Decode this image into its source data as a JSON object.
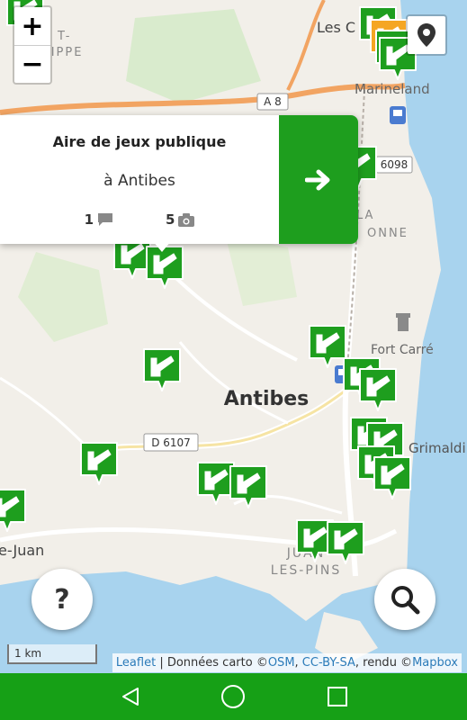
{
  "map": {
    "labels": {
      "antibes": "Antibes",
      "les_c": "Les C",
      "marineland": "Marineland",
      "fort_carre": "Fort Carré",
      "grimaldi": "Grimaldi",
      "juan_les_pins_1": "JUAN",
      "juan_les_pins_2": "LES-PINS",
      "juan_left": "e-Juan",
      "philippe": "PHILIPPE",
      "la": "LA",
      "onne": "ONNE",
      "t_frag": "T-"
    },
    "road_shields": {
      "a8": "A 8",
      "d6107": "D 6107",
      "r6098": "6098"
    },
    "colors": {
      "land": "#f2efe9",
      "sea": "#a8d3ee",
      "road": "#ffffff",
      "motorway": "#f2a462",
      "park": "#cfe9c0",
      "marker_green": "#1e9e1e",
      "marker_orange": "#f5a623"
    }
  },
  "zoom": {
    "in_label": "+",
    "out_label": "−"
  },
  "popup": {
    "title": "Aire de jeux publique",
    "location": "à Antibes",
    "comments_count": "1",
    "photos_count": "5",
    "comment_icon": "speech-bubble-icon",
    "photo_icon": "camera-icon",
    "go_icon": "arrow-right-icon"
  },
  "help_button": {
    "label": "?"
  },
  "search_button": {
    "icon": "magnifier-icon"
  },
  "locate_button": {
    "icon": "location-pin-icon"
  },
  "scale": {
    "label": "1 km"
  },
  "attribution": {
    "leaflet": "Leaflet",
    "sep": " | Données carto ©",
    "osm": "OSM",
    "comma": ", ",
    "license": "CC-BY-SA",
    "rendered": ", rendu ©",
    "mapbox": "Mapbox"
  },
  "navbar": {
    "back_icon": "triangle-back-icon",
    "home_icon": "circle-home-icon",
    "recents_icon": "square-recents-icon"
  }
}
